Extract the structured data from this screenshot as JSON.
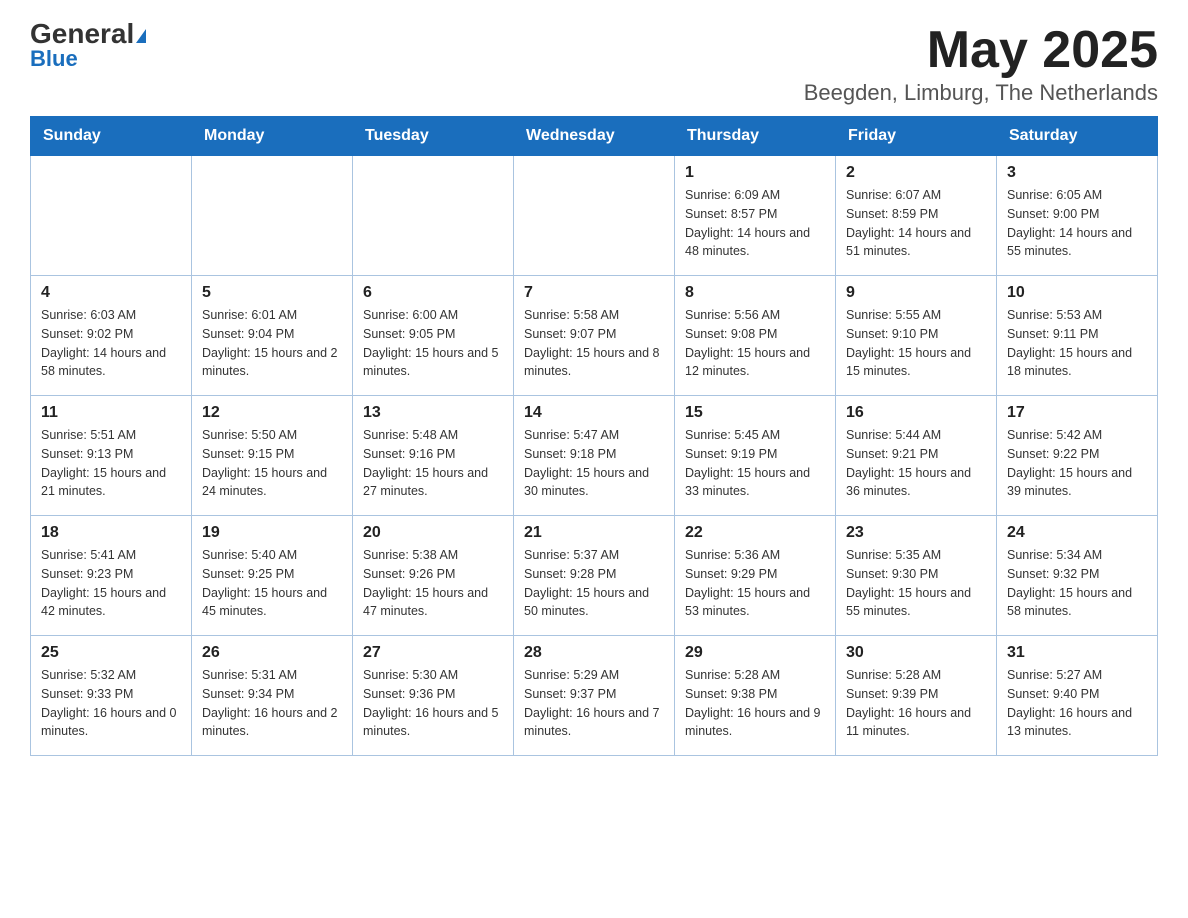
{
  "header": {
    "logo_general": "General",
    "logo_blue": "Blue",
    "title": "May 2025",
    "subtitle": "Beegden, Limburg, The Netherlands"
  },
  "days_of_week": [
    "Sunday",
    "Monday",
    "Tuesday",
    "Wednesday",
    "Thursday",
    "Friday",
    "Saturday"
  ],
  "weeks": [
    [
      {
        "day": "",
        "info": ""
      },
      {
        "day": "",
        "info": ""
      },
      {
        "day": "",
        "info": ""
      },
      {
        "day": "",
        "info": ""
      },
      {
        "day": "1",
        "info": "Sunrise: 6:09 AM\nSunset: 8:57 PM\nDaylight: 14 hours and 48 minutes."
      },
      {
        "day": "2",
        "info": "Sunrise: 6:07 AM\nSunset: 8:59 PM\nDaylight: 14 hours and 51 minutes."
      },
      {
        "day": "3",
        "info": "Sunrise: 6:05 AM\nSunset: 9:00 PM\nDaylight: 14 hours and 55 minutes."
      }
    ],
    [
      {
        "day": "4",
        "info": "Sunrise: 6:03 AM\nSunset: 9:02 PM\nDaylight: 14 hours and 58 minutes."
      },
      {
        "day": "5",
        "info": "Sunrise: 6:01 AM\nSunset: 9:04 PM\nDaylight: 15 hours and 2 minutes."
      },
      {
        "day": "6",
        "info": "Sunrise: 6:00 AM\nSunset: 9:05 PM\nDaylight: 15 hours and 5 minutes."
      },
      {
        "day": "7",
        "info": "Sunrise: 5:58 AM\nSunset: 9:07 PM\nDaylight: 15 hours and 8 minutes."
      },
      {
        "day": "8",
        "info": "Sunrise: 5:56 AM\nSunset: 9:08 PM\nDaylight: 15 hours and 12 minutes."
      },
      {
        "day": "9",
        "info": "Sunrise: 5:55 AM\nSunset: 9:10 PM\nDaylight: 15 hours and 15 minutes."
      },
      {
        "day": "10",
        "info": "Sunrise: 5:53 AM\nSunset: 9:11 PM\nDaylight: 15 hours and 18 minutes."
      }
    ],
    [
      {
        "day": "11",
        "info": "Sunrise: 5:51 AM\nSunset: 9:13 PM\nDaylight: 15 hours and 21 minutes."
      },
      {
        "day": "12",
        "info": "Sunrise: 5:50 AM\nSunset: 9:15 PM\nDaylight: 15 hours and 24 minutes."
      },
      {
        "day": "13",
        "info": "Sunrise: 5:48 AM\nSunset: 9:16 PM\nDaylight: 15 hours and 27 minutes."
      },
      {
        "day": "14",
        "info": "Sunrise: 5:47 AM\nSunset: 9:18 PM\nDaylight: 15 hours and 30 minutes."
      },
      {
        "day": "15",
        "info": "Sunrise: 5:45 AM\nSunset: 9:19 PM\nDaylight: 15 hours and 33 minutes."
      },
      {
        "day": "16",
        "info": "Sunrise: 5:44 AM\nSunset: 9:21 PM\nDaylight: 15 hours and 36 minutes."
      },
      {
        "day": "17",
        "info": "Sunrise: 5:42 AM\nSunset: 9:22 PM\nDaylight: 15 hours and 39 minutes."
      }
    ],
    [
      {
        "day": "18",
        "info": "Sunrise: 5:41 AM\nSunset: 9:23 PM\nDaylight: 15 hours and 42 minutes."
      },
      {
        "day": "19",
        "info": "Sunrise: 5:40 AM\nSunset: 9:25 PM\nDaylight: 15 hours and 45 minutes."
      },
      {
        "day": "20",
        "info": "Sunrise: 5:38 AM\nSunset: 9:26 PM\nDaylight: 15 hours and 47 minutes."
      },
      {
        "day": "21",
        "info": "Sunrise: 5:37 AM\nSunset: 9:28 PM\nDaylight: 15 hours and 50 minutes."
      },
      {
        "day": "22",
        "info": "Sunrise: 5:36 AM\nSunset: 9:29 PM\nDaylight: 15 hours and 53 minutes."
      },
      {
        "day": "23",
        "info": "Sunrise: 5:35 AM\nSunset: 9:30 PM\nDaylight: 15 hours and 55 minutes."
      },
      {
        "day": "24",
        "info": "Sunrise: 5:34 AM\nSunset: 9:32 PM\nDaylight: 15 hours and 58 minutes."
      }
    ],
    [
      {
        "day": "25",
        "info": "Sunrise: 5:32 AM\nSunset: 9:33 PM\nDaylight: 16 hours and 0 minutes."
      },
      {
        "day": "26",
        "info": "Sunrise: 5:31 AM\nSunset: 9:34 PM\nDaylight: 16 hours and 2 minutes."
      },
      {
        "day": "27",
        "info": "Sunrise: 5:30 AM\nSunset: 9:36 PM\nDaylight: 16 hours and 5 minutes."
      },
      {
        "day": "28",
        "info": "Sunrise: 5:29 AM\nSunset: 9:37 PM\nDaylight: 16 hours and 7 minutes."
      },
      {
        "day": "29",
        "info": "Sunrise: 5:28 AM\nSunset: 9:38 PM\nDaylight: 16 hours and 9 minutes."
      },
      {
        "day": "30",
        "info": "Sunrise: 5:28 AM\nSunset: 9:39 PM\nDaylight: 16 hours and 11 minutes."
      },
      {
        "day": "31",
        "info": "Sunrise: 5:27 AM\nSunset: 9:40 PM\nDaylight: 16 hours and 13 minutes."
      }
    ]
  ]
}
